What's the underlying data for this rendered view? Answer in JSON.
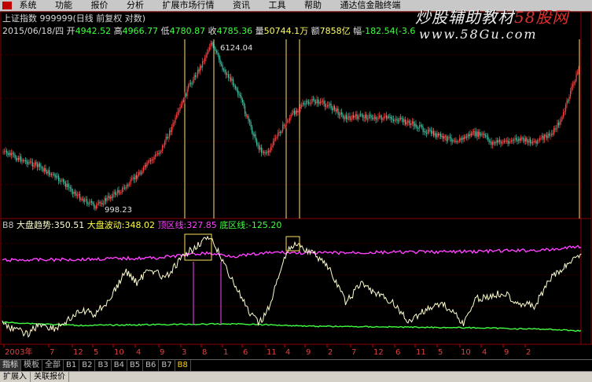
{
  "menu": [
    "系统",
    "功能",
    "报价",
    "分析",
    "扩展市场行情",
    "资讯",
    "工具",
    "帮助",
    "通达信金融终端"
  ],
  "watermark": {
    "part1": "炒股辅助教材",
    "part2": "58股网",
    "url": "www.58Gu.com"
  },
  "title_line": "上证指数 999999(日线 前复权 对数)",
  "quote": {
    "date": "2015/06/18/四",
    "open_label": "开",
    "open": "4942.52",
    "high_label": "高",
    "high": "4966.77",
    "low_label": "低",
    "low": "4780.87",
    "close_label": "收",
    "close": "4785.36",
    "vol_label": "量",
    "vol": "50744.1万",
    "amount_label": "额",
    "amount": "7858亿",
    "change_label": "幅",
    "change": "-182.54(-3.6"
  },
  "price_labels": {
    "high": "6124.04",
    "low": "998.23"
  },
  "indicator": {
    "name": "B8",
    "trend_label": "大盘趋势:",
    "trend": "350.51",
    "wave_label": "大盘波动:",
    "wave": "348.02",
    "top_label": "顶区线:",
    "top": "327.85",
    "bottom_label": "底区线:",
    "bottom": "-125.20"
  },
  "axis_labels": [
    "2003年",
    "7",
    "12",
    "5",
    "10",
    "4",
    "9",
    "3",
    "8",
    "1",
    "6",
    "11",
    "4",
    "9",
    "2",
    "7",
    "12",
    "6",
    "11",
    "5",
    "10",
    "4",
    "9",
    "2"
  ],
  "tabs": [
    "指标",
    "模板",
    "全部",
    "B1",
    "B2",
    "B3",
    "B4",
    "B5",
    "B6",
    "B7",
    "B8"
  ],
  "bottom_tabs": [
    "扩展入",
    "关联报价"
  ],
  "colors": {
    "background": "#000000",
    "grid": "#8b0000",
    "up_candle": "#ff4040",
    "down_candle": "#40c0a0",
    "vertical_marker": "#ffe080",
    "trend_line": "#ffffd0",
    "top_line": "#ff40ff",
    "bottom_line": "#40ff40",
    "annotation_box": "#ffe060"
  }
}
